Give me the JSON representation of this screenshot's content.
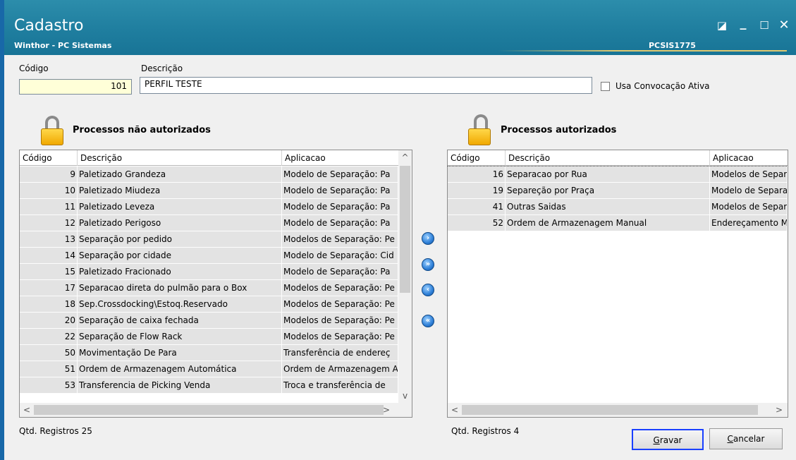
{
  "window": {
    "title": "Cadastro",
    "subtitle": "Winthor - PC Sistemas",
    "code": "PCSIS1775",
    "restore_glyph": "◪",
    "min_glyph": "_",
    "max_glyph": "☐",
    "close_glyph": "✕"
  },
  "form": {
    "codigo_label": "Código",
    "codigo_value": "101",
    "descricao_label": "Descrição",
    "descricao_value": "PERFIL TESTE",
    "convocacao_label": "Usa Convocação Ativa",
    "convocacao_checked": false
  },
  "left": {
    "title": "Processos não autorizados",
    "columns": [
      "Código",
      "Descrição",
      "Aplicacao"
    ],
    "rows": [
      {
        "code": "9",
        "desc": "Paletizado Grandeza",
        "app": "Modelo de Separação: Pa"
      },
      {
        "code": "10",
        "desc": "Paletizado Miudeza",
        "app": "Modelo de Separação: Pa"
      },
      {
        "code": "11",
        "desc": "Paletizado Leveza",
        "app": "Modelo de Separação: Pa"
      },
      {
        "code": "12",
        "desc": "Paletizado Perigoso",
        "app": "Modelo de Separação: Pa"
      },
      {
        "code": "13",
        "desc": "Separação por pedido",
        "app": "Modelos de Separação: Pe"
      },
      {
        "code": "14",
        "desc": "Separação por cidade",
        "app": "Modelo de Separação: Cid"
      },
      {
        "code": "15",
        "desc": "Paletizado Fracionado",
        "app": "Modelo de Separação: Pa"
      },
      {
        "code": "17",
        "desc": "Separacao direta do pulmão para o Box",
        "app": "Modelos de Separação: Pe"
      },
      {
        "code": "18",
        "desc": "Sep.Crossdocking\\Estoq.Reservado",
        "app": "Modelos de Separação: Pe"
      },
      {
        "code": "20",
        "desc": "Separação de caixa fechada",
        "app": "Modelos de Separação: Pe"
      },
      {
        "code": "22",
        "desc": "Separação de Flow Rack",
        "app": "Modelos de Separação: Pe"
      },
      {
        "code": "50",
        "desc": "Movimentação De Para",
        "app": "Transferência de endereç"
      },
      {
        "code": "51",
        "desc": "Ordem de Armazenagem Automática",
        "app": "Ordem de Armazenagem A"
      },
      {
        "code": "53",
        "desc": "Transferencia de Picking Venda",
        "app": "Troca e transferência de"
      }
    ],
    "count_label": "Qtd. Registros 25",
    "scroll_up": "^",
    "scroll_down": "v",
    "scroll_left": "<",
    "scroll_right": ">"
  },
  "right": {
    "title": "Processos autorizados",
    "columns": [
      "Código",
      "Descrição",
      "Aplicacao"
    ],
    "rows": [
      {
        "code": "16",
        "desc": "Separacao por Rua",
        "app": "Modelos de Separa"
      },
      {
        "code": "19",
        "desc": "Separeção por Praça",
        "app": "Modelo de Separa"
      },
      {
        "code": "41",
        "desc": "Outras Saidas",
        "app": "Modelos de Separa"
      },
      {
        "code": "52",
        "desc": "Ordem de Armazenagem Manual",
        "app": "Endereçamento Ma"
      }
    ],
    "count_label": "Qtd. Registros  4",
    "scroll_left": "<",
    "scroll_right": ">"
  },
  "move_buttons": [
    {
      "name": "move-right-button",
      "glyph": "›"
    },
    {
      "name": "move-all-right-button",
      "glyph": "»"
    },
    {
      "name": "move-left-button",
      "glyph": "‹"
    },
    {
      "name": "move-all-left-button",
      "glyph": "«"
    }
  ],
  "buttons": {
    "gravar_first": "G",
    "gravar_rest": "ravar",
    "cancelar_first": "C",
    "cancelar_rest": "ancelar"
  }
}
